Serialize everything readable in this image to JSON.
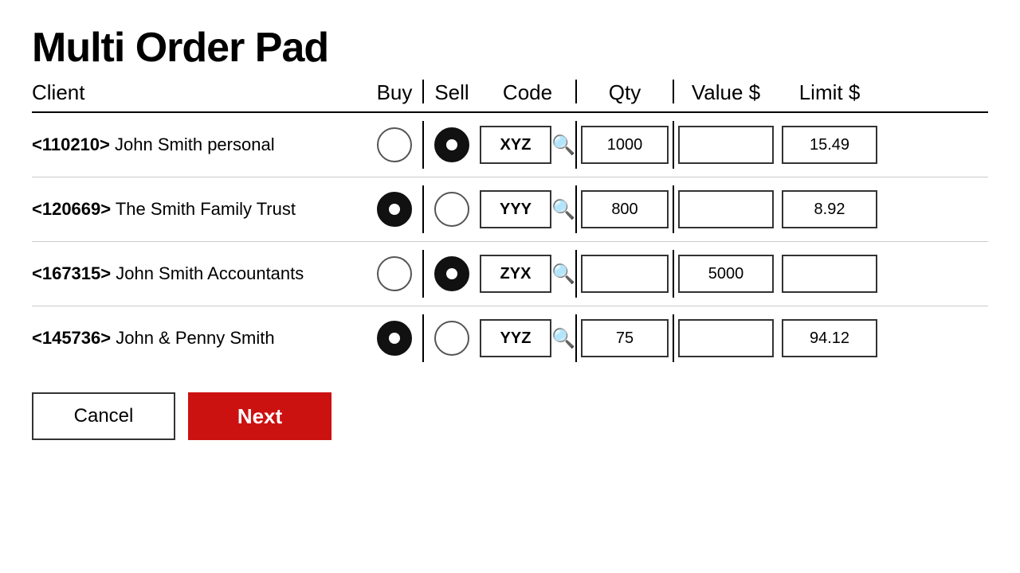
{
  "title": "Multi Order Pad",
  "columns": {
    "client": "Client",
    "buy": "Buy",
    "sell": "Sell",
    "code": "Code",
    "qty": "Qty",
    "value": "Value $",
    "limit": "Limit $"
  },
  "rows": [
    {
      "id": "110210",
      "name": "John Smith personal",
      "buy_selected": false,
      "sell_selected": true,
      "code": "XYZ",
      "qty": "1000",
      "value": "",
      "limit": "15.49"
    },
    {
      "id": "120669",
      "name": "The Smith Family Trust",
      "buy_selected": true,
      "sell_selected": false,
      "code": "YYY",
      "qty": "800",
      "value": "",
      "limit": "8.92"
    },
    {
      "id": "167315",
      "name": "John Smith Accountants",
      "buy_selected": false,
      "sell_selected": true,
      "code": "ZYX",
      "qty": "",
      "value": "5000",
      "limit": ""
    },
    {
      "id": "145736",
      "name": "John & Penny Smith",
      "buy_selected": true,
      "sell_selected": false,
      "code": "YYZ",
      "qty": "75",
      "value": "",
      "limit": "94.12"
    }
  ],
  "buttons": {
    "cancel": "Cancel",
    "next": "Next"
  }
}
